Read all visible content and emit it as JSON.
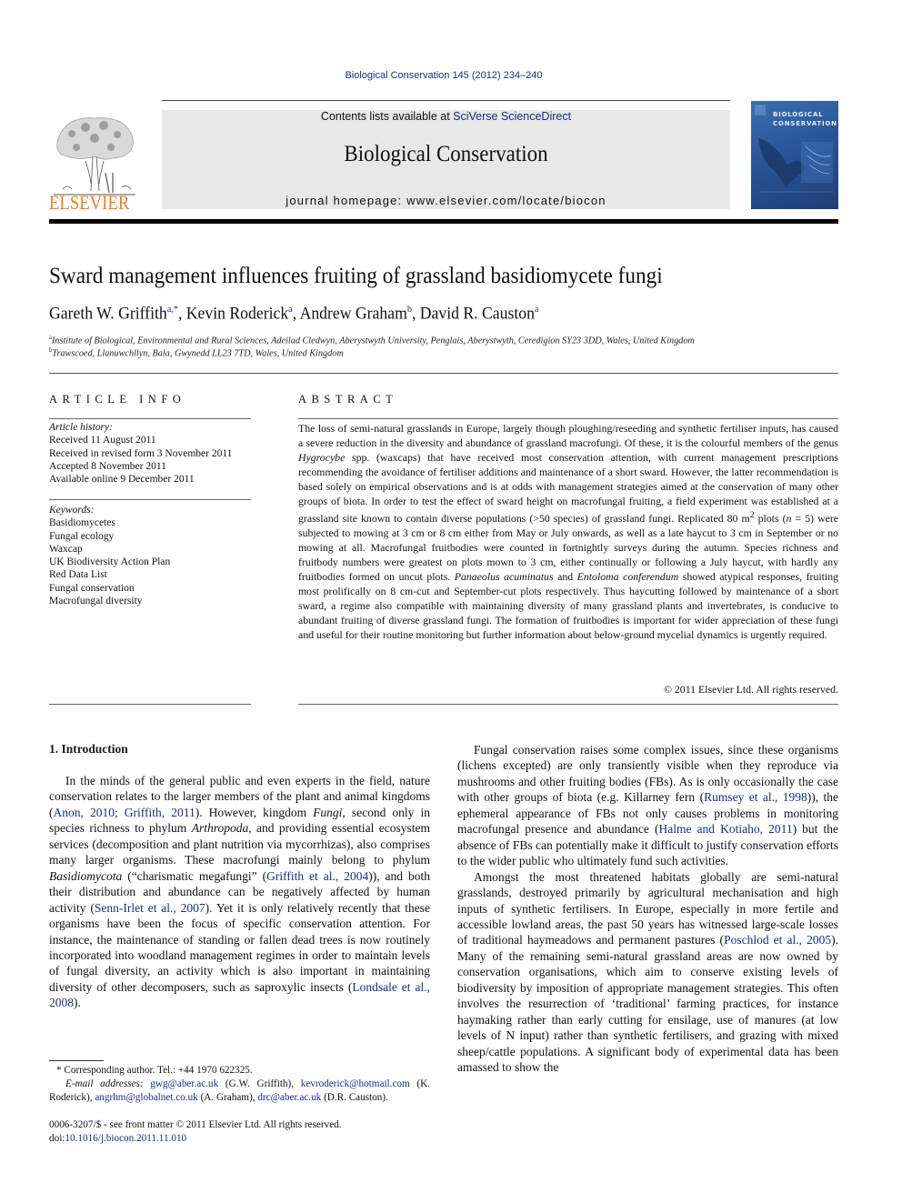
{
  "running_head": "Biological Conservation 145 (2012) 234–240",
  "masthead": {
    "contents_prefix": "Contents lists available at ",
    "contents_link": "SciVerse ScienceDirect",
    "journal_name": "Biological Conservation",
    "homepage": "journal homepage: www.elsevier.com/locate/biocon",
    "publisher_logo_text": "ELSEVIER",
    "cover_title_line1": "BIOLOGICAL",
    "cover_title_line2": "CONSERVATION"
  },
  "article": {
    "title": "Sward management influences fruiting of grassland basidiomycete fungi",
    "authors": [
      {
        "name": "Gareth W. Griffith",
        "sup": "a,*"
      },
      {
        "name": "Kevin Roderick",
        "sup": "a"
      },
      {
        "name": "Andrew Graham",
        "sup": "b"
      },
      {
        "name": "David R. Causton",
        "sup": "a"
      }
    ],
    "affiliations": [
      {
        "sup": "a",
        "text": "Institute of Biological, Environmental and Rural Sciences, Adeilad Cledwyn, Aberystwyth University, Penglais, Aberystwyth, Ceredigion SY23 3DD, Wales, United Kingdom"
      },
      {
        "sup": "b",
        "text": "Trawscoed, Llanuwchllyn, Bala, Gwynedd LL23 7TD, Wales, United Kingdom"
      }
    ]
  },
  "article_info": {
    "heading": "ARTICLE INFO",
    "history_label": "Article history:",
    "history": [
      "Received 11 August 2011",
      "Received in revised form 3 November 2011",
      "Accepted 8 November 2011",
      "Available online 9 December 2011"
    ],
    "keywords_label": "Keywords:",
    "keywords": [
      "Basidiomycetes",
      "Fungal ecology",
      "Waxcap",
      "UK Biodiversity Action Plan",
      "Red Data List",
      "Fungal conservation",
      "Macrofungal diversity"
    ]
  },
  "abstract": {
    "heading": "ABSTRACT",
    "p1": "The loss of semi-natural grasslands in Europe, largely though ploughing/reseeding and synthetic fertiliser inputs, has caused a severe reduction in the diversity and abundance of grassland macrofungi. Of these, it is the colourful members of the genus ",
    "genus": "Hygrocybe",
    "p2": " spp. (waxcaps) that have received most conservation attention, with current management prescriptions recommending the avoidance of fertiliser additions and maintenance of a short sward. However, the latter recommendation is based solely on empirical observations and is at odds with management strategies aimed at the conservation of many other groups of biota. In order to test the effect of sward height on macrofungal fruiting, a field experiment was established at a grassland site known to contain diverse populations (>50 species) of grassland fungi. Replicated 80 m",
    "p2_sup": "2",
    "p3": " plots (",
    "n_var": "n",
    "p4": " = 5) were subjected to mowing at 3 cm or 8 cm either from May or July onwards, as well as a late haycut to 3 cm in September or no mowing at all. Macrofungal fruitbodies were counted in fortnightly surveys during the autumn. Species richness and fruitbody numbers were greatest on plots mown to 3 cm, either continually or following a July haycut, with hardly any fruitbodies formed on uncut plots. ",
    "species1": "Panaeolus acuminatus",
    "p5": " and ",
    "species2": "Entoloma conferendum",
    "p6": " showed atypical responses, fruiting most prolifically on 8 cm-cut and September-cut plots respectively. Thus haycutting followed by maintenance of a short sward, a regime also compatible with maintaining diversity of many grassland plants and invertebrates, is conducive to abundant fruiting of diverse grassland fungi. The formation of fruitbodies is important for wider appreciation of these fungi and useful for their routine monitoring but further information about below-ground mycelial dynamics is urgently required.",
    "copyright": "© 2011 Elsevier Ltd. All rights reserved."
  },
  "introduction": {
    "heading": "1. Introduction",
    "para1": {
      "t1": "In the minds of the general public and even experts in the field, nature conservation relates to the larger members of the plant and animal kingdoms (",
      "ref1": "Anon, 2010; Griffith, 2011",
      "t2": "). However, kingdom ",
      "i1": "Fungi",
      "t3": ", second only in species richness to phylum ",
      "i2": "Arthropoda",
      "t4": ", and providing essential ecosystem services (decomposition and plant nutrition via mycorrhizas), also comprises many larger organisms. These macrofungi mainly belong to phylum ",
      "i3": "Basidiomycota",
      "t5": " (“charismatic megafungi” (",
      "ref2": "Griffith et al., 2004",
      "t6": ")), and both their distribution and abundance can be negatively affected by human activity (",
      "ref3": "Senn-Irlet et al., 2007",
      "t7": "). Yet it is only relatively recently that these organisms have been the focus of specific conservation attention. For instance, the maintenance of standing or fallen dead trees is now routinely incorporated into woodland management regimes in order to maintain levels of fungal diversity, an activity which is also important in maintaining diversity of other decomposers, such as saproxylic insects (",
      "ref4": "Londsale et al., 2008",
      "t8": ")."
    },
    "para2": {
      "t1": "Fungal conservation raises some complex issues, since these organisms (lichens excepted) are only transiently visible when they reproduce via mushrooms and other fruiting bodies (FBs). As is only occasionally the case with other groups of biota (e.g. Killarney fern (",
      "ref1": "Rumsey et al., 1998",
      "t2": ")), the ephemeral appearance of FBs not only causes problems in monitoring macrofungal presence and abundance (",
      "ref2": "Halme and Kotiaho, 2011",
      "t3": ") but the absence of FBs can potentially make it difficult to justify conservation efforts to the wider public who ultimately fund such activities."
    },
    "para3": {
      "t1": "Amongst the most threatened habitats globally are semi-natural grasslands, destroyed primarily by agricultural mechanisation and high inputs of synthetic fertilisers. In Europe, especially in more fertile and accessible lowland areas, the past 50 years has witnessed large-scale losses of traditional haymeadows and permanent pastures (",
      "ref1": "Poschlod et al., 2005",
      "t2": "). Many of the remaining semi-natural grassland areas are now owned by conservation organisations, which aim to conserve existing levels of biodiversity by imposition of appropriate management strategies. This often involves the resurrection of ‘traditional’ farming practices, for instance haymaking rather than early cutting for ensilage, use of manures (at low levels of N input) rather than synthetic fertilisers, and grazing with mixed sheep/cattle populations. A significant body of experimental data has been amassed to show the"
    }
  },
  "footnotes": {
    "corresponding": "Corresponding author. Tel.: +44 1970 622325.",
    "email_label": "E-mail addresses:",
    "emails": [
      {
        "addr": "gwg@aber.ac.uk",
        "who": "(G.W. Griffith),"
      },
      {
        "addr": "kevroderick@hotmail.com",
        "who": "(K. Roderick),"
      },
      {
        "addr": "angrhm@globalnet.co.uk",
        "who": "(A. Graham),"
      },
      {
        "addr": "drc@aber.ac.uk",
        "who": "(D.R. Causton)."
      }
    ],
    "front_matter": "0006-3207/$ - see front matter © 2011 Elsevier Ltd. All rights reserved.",
    "doi_prefix": "doi:",
    "doi": "10.1016/j.biocon.2011.11.010"
  },
  "colors": {
    "link": "#1b2a8a",
    "elsevier_orange": "#f07d1a",
    "masthead_bg": "#e8e8e8",
    "cover_blue": "#2a5596"
  }
}
